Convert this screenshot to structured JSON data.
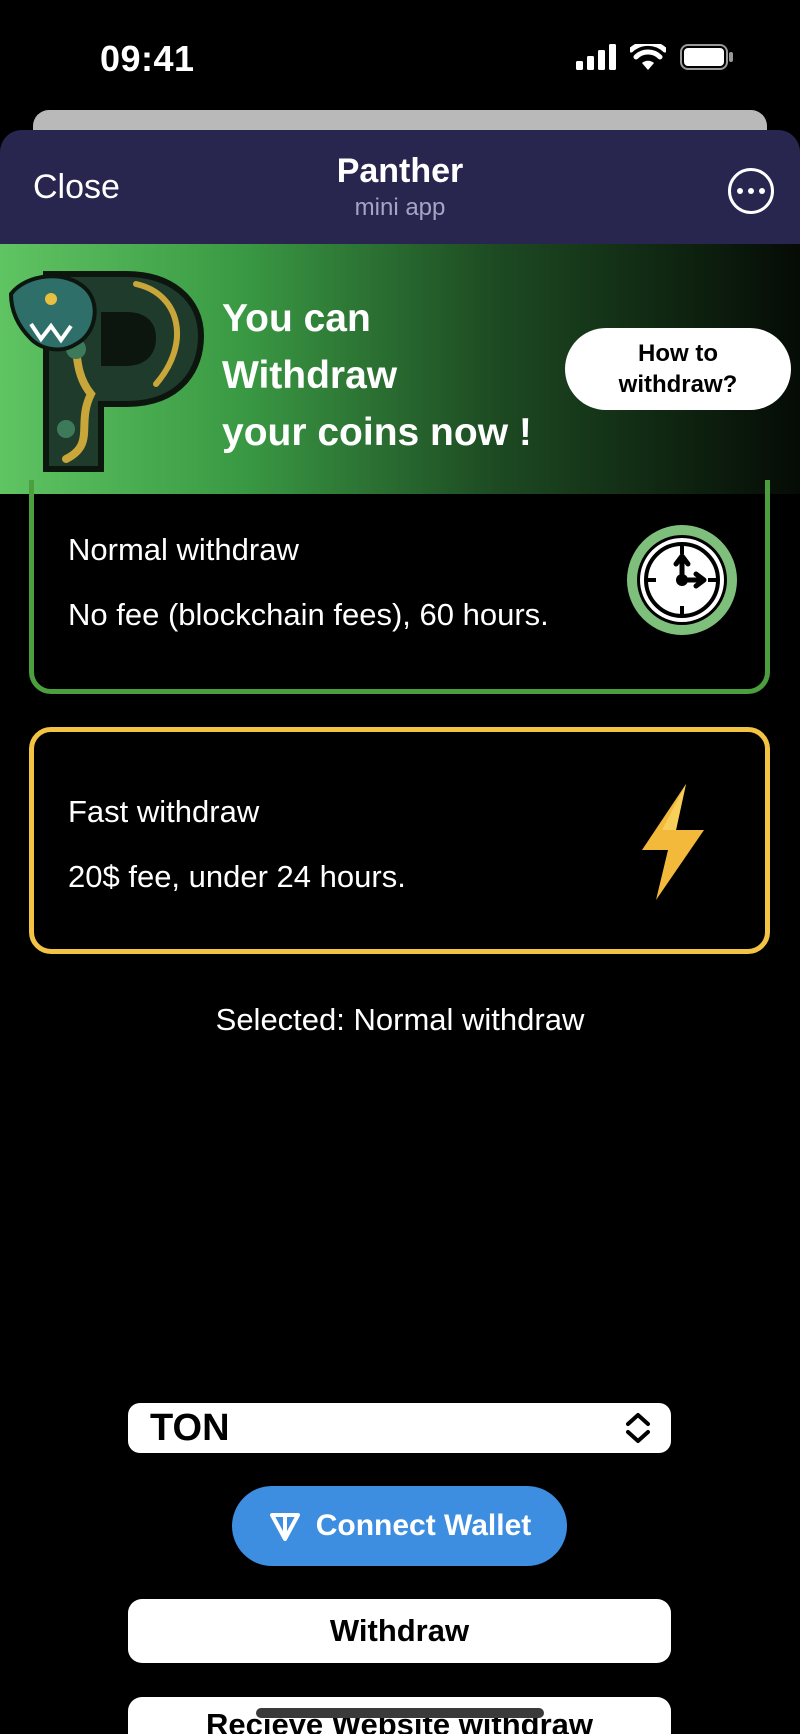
{
  "status_bar": {
    "time": "09:41"
  },
  "header": {
    "close_label": "Close",
    "title": "Panther",
    "subtitle": "mini app",
    "more_icon": "ellipsis-circle-icon"
  },
  "banner": {
    "line1": "You can",
    "line2": "Withdraw",
    "line3": "your coins now !",
    "howto_label": "How to\nwithdraw?",
    "logo": "panther-p-logo"
  },
  "options": [
    {
      "title": "Normal withdraw",
      "description": "No fee (blockchain fees), 60 hours.",
      "icon": "clock-icon",
      "border_color": "#4c9e3e"
    },
    {
      "title": "Fast withdraw",
      "description": "20$ fee, under 24 hours.",
      "icon": "lightning-icon",
      "border_color": "#f3c443"
    }
  ],
  "selected_label": "Selected: Normal withdraw",
  "currency_select": {
    "value": "TON",
    "icon": "chevron-up-down-icon"
  },
  "connect_wallet": {
    "label": "Connect Wallet",
    "icon": "ton-icon",
    "color": "#3d8ee0"
  },
  "withdraw_button": {
    "label": "Withdraw"
  },
  "website_button": {
    "label": "Recieve Website withdraw"
  }
}
